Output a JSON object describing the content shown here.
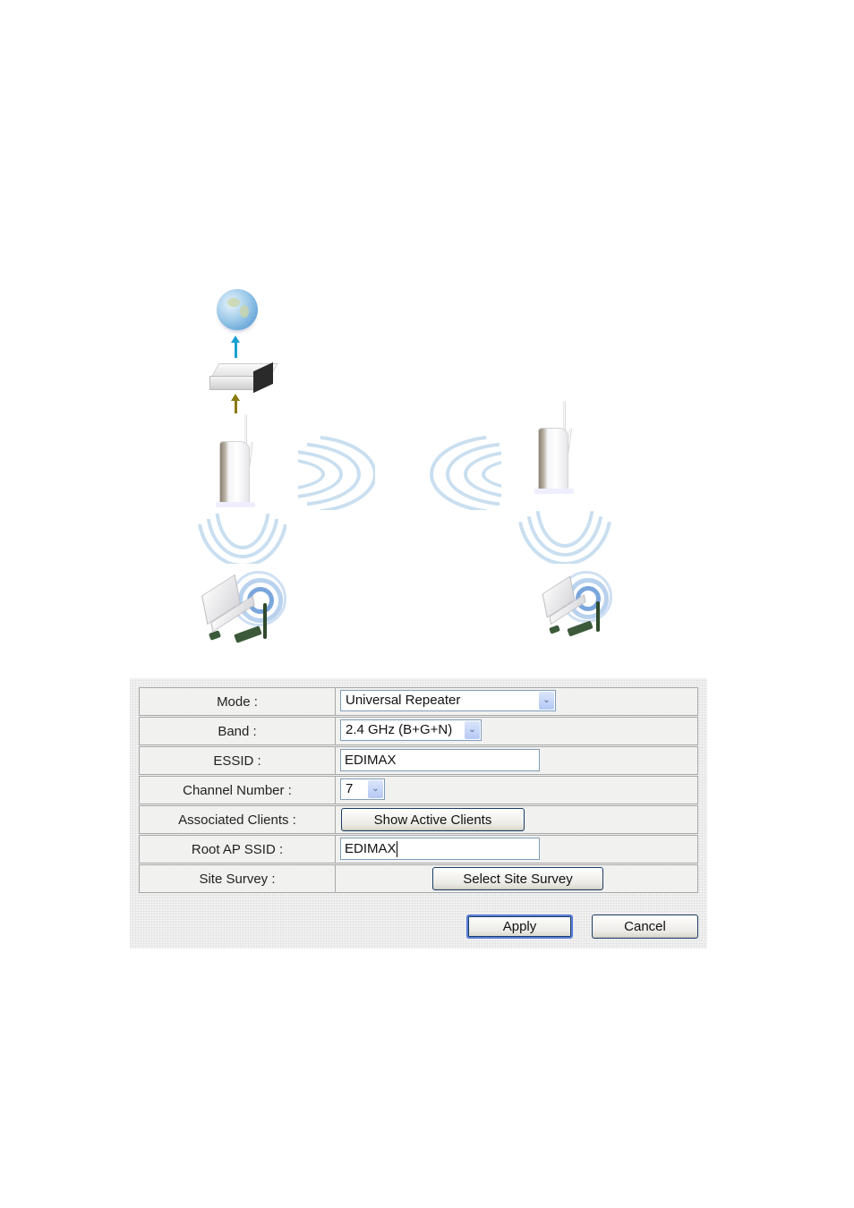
{
  "diagram": {
    "icons": [
      "globe-icon",
      "modem-icon",
      "root-access-point-icon",
      "repeater-access-point-icon",
      "wireless-client-icon",
      "wireless-client-icon"
    ],
    "arrow_colors": {
      "internet_link": "#1aa0d0",
      "wired_link": "#8a7a10"
    },
    "wave_color": "#c9dff0"
  },
  "form": {
    "rows": [
      {
        "label": "Mode :",
        "type": "select",
        "value": "Universal Repeater"
      },
      {
        "label": "Band :",
        "type": "select",
        "value": "2.4 GHz (B+G+N)"
      },
      {
        "label": "ESSID :",
        "type": "input",
        "value": "EDIMAX"
      },
      {
        "label": "Channel Number :",
        "type": "select",
        "value": "7"
      },
      {
        "label": "Associated Clients :",
        "type": "button",
        "value": "Show Active Clients"
      },
      {
        "label": "Root AP SSID :",
        "type": "input",
        "value": "EDIMAX"
      },
      {
        "label": "Site Survey :",
        "type": "button",
        "value": "Select Site Survey"
      }
    ],
    "apply_label": "Apply",
    "cancel_label": "Cancel",
    "dropdown_glyph": "⌄"
  }
}
